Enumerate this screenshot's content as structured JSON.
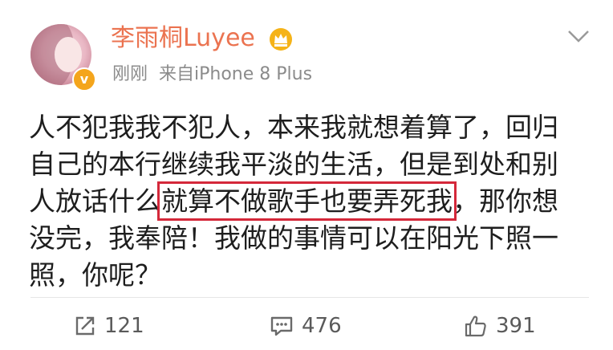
{
  "post": {
    "username": "李雨桐Luyee",
    "timestamp": "刚刚",
    "source": "来自iPhone 8 Plus",
    "text": {
      "line1": "人不犯我我不犯人，本来我就想着算了，回归",
      "line2": "自己的本行继续我平淡的生活，但是到处和别",
      "line3_before": "人放话什么",
      "line3_highlight": "就算不做歌手也要弄死我",
      "line3_after": "，那你想",
      "line4": "没完，我奉陪！我做的事情可以在阳光下照一",
      "line5": "照，你呢？"
    }
  },
  "actions": {
    "repost_count": "121",
    "comment_count": "476",
    "like_count": "391"
  },
  "colors": {
    "username": "#eb7350",
    "meta": "#8b8b8b",
    "highlight_border": "#d4283a",
    "verified_badge": "#f4a51c"
  },
  "icons": [
    "verified-badge-icon",
    "crown-icon",
    "chevron-down-icon",
    "repost-icon",
    "comment-icon",
    "like-icon"
  ]
}
